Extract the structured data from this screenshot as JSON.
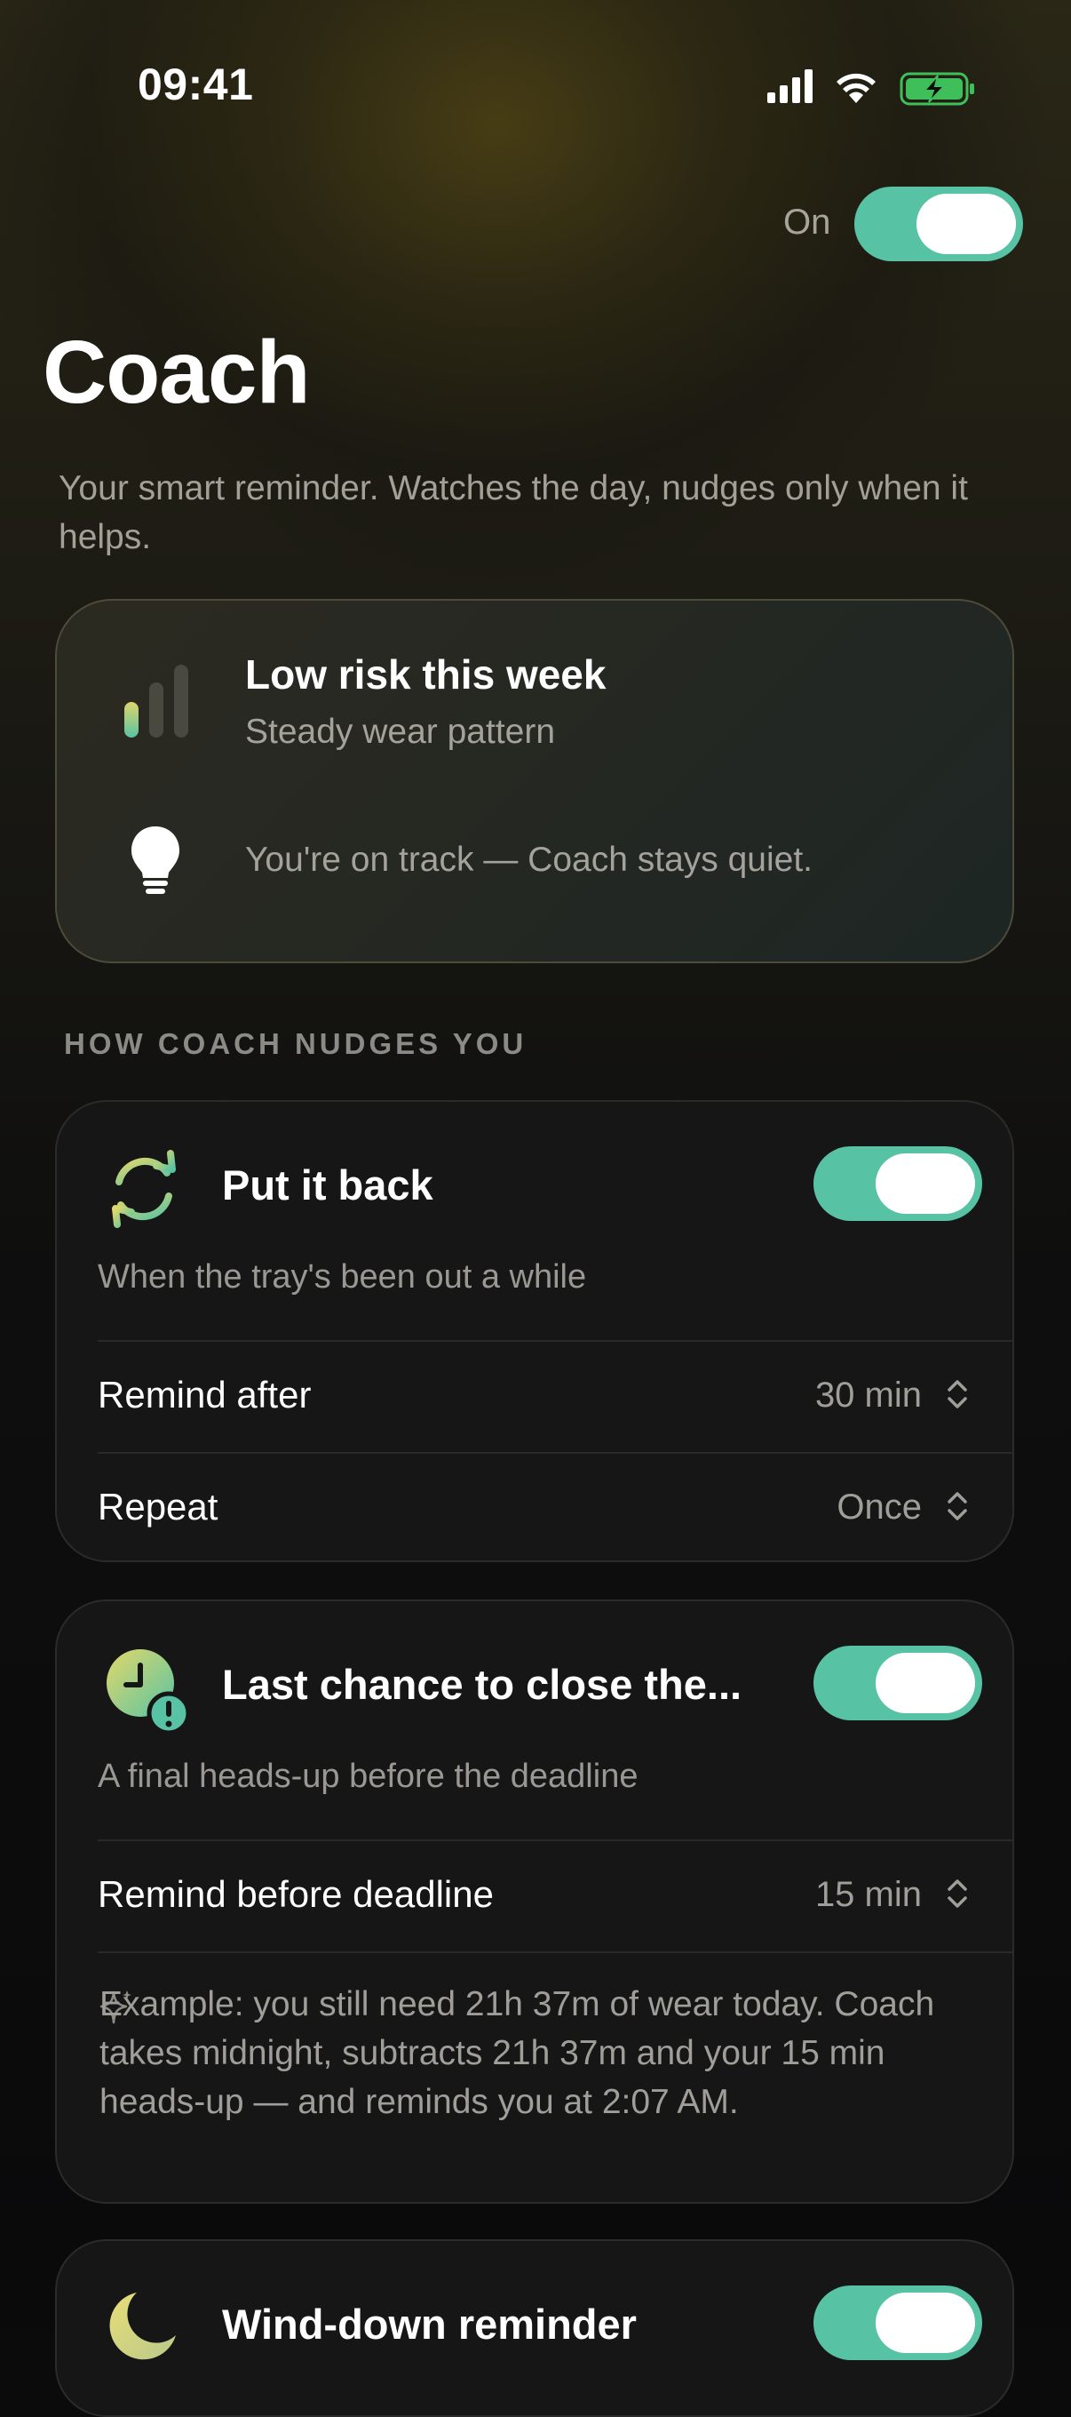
{
  "status_bar": {
    "time": "09:41"
  },
  "header": {
    "master_toggle_label": "On",
    "master_toggle_on": true,
    "title": "Coach",
    "subtitle": "Your smart reminder. Watches the day, nudges only when it helps."
  },
  "risk_card": {
    "title": "Low risk this week",
    "subtitle": "Steady wear pattern",
    "note": "You're on track — Coach stays quiet."
  },
  "section_header": "HOW COACH NUDGES YOU",
  "nudges": [
    {
      "icon": "sync-arrows-icon",
      "title": "Put it back",
      "enabled": true,
      "description": "When the tray's been out a while",
      "rows": [
        {
          "label": "Remind after",
          "value": "30 min"
        },
        {
          "label": "Repeat",
          "value": "Once"
        }
      ]
    },
    {
      "icon": "clock-alert-icon",
      "title": "Last chance to close the...",
      "enabled": true,
      "description": "A final heads-up before the deadline",
      "rows": [
        {
          "label": "Remind before deadline",
          "value": "15 min"
        }
      ],
      "example": "Example: you still need 21h 37m of wear today. Coach takes midnight, subtracts 21h 37m and your 15 min heads-up — and reminds you at 2:07 AM."
    },
    {
      "icon": "moon-icon",
      "title": "Wind-down reminder",
      "enabled": true
    }
  ],
  "colors": {
    "accent": "#57c3a4",
    "background": "#0b0b0c",
    "card": "#161617",
    "muted_text": "#a09e98"
  }
}
